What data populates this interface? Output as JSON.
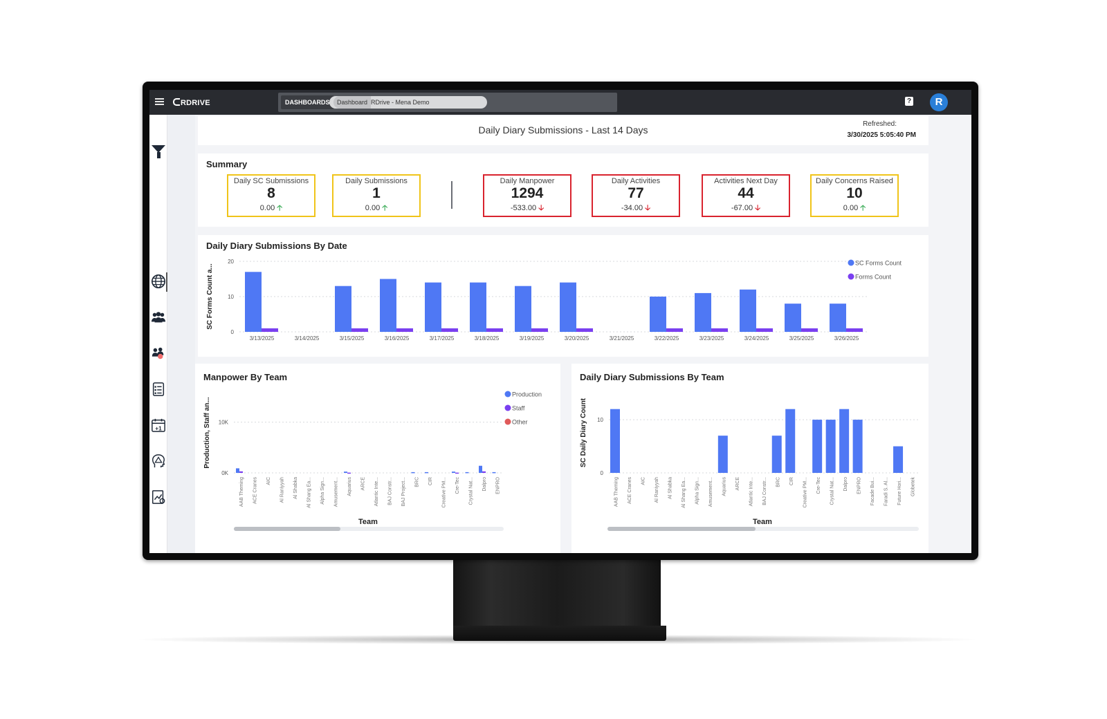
{
  "topbar": {
    "brand": "RDRIVE",
    "nav_tab": "DASHBOARDS",
    "crumb_1": "Dashboard",
    "crumb_2": "RDrive - Mena Demo",
    "help_icon": "help-icon",
    "avatar_letter": "R"
  },
  "sidebar": {
    "icons": [
      "filter-icon",
      "globe-icon",
      "team-icon",
      "team-alert-icon",
      "checklist-icon",
      "calendar-plus-icon",
      "head-alert-icon",
      "report-chart-icon"
    ]
  },
  "header": {
    "title": "Daily Diary Submissions - Last 14 Days",
    "refreshed_label": "Refreshed:",
    "refreshed_value": "3/30/2025 5:05:40 PM"
  },
  "summary": {
    "title": "Summary",
    "cards": [
      {
        "label": "Daily SC Submissions",
        "value": "8",
        "delta": "0.00",
        "trend": "up",
        "border": "#f0c419"
      },
      {
        "label": "Daily Submissions",
        "value": "1",
        "delta": "0.00",
        "trend": "up",
        "border": "#f0c419"
      },
      {
        "label": "Daily Manpower",
        "value": "1294",
        "delta": "-533.00",
        "trend": "down",
        "border": "#d9232e"
      },
      {
        "label": "Daily Activities",
        "value": "77",
        "delta": "-34.00",
        "trend": "down",
        "border": "#d9232e"
      },
      {
        "label": "Activities Next Day",
        "value": "44",
        "delta": "-67.00",
        "trend": "down",
        "border": "#d9232e"
      },
      {
        "label": "Daily Concerns Raised",
        "value": "10",
        "delta": "0.00",
        "trend": "up",
        "border": "#f0c419"
      }
    ]
  },
  "colors": {
    "blue": "#4f78f4",
    "purple": "#7a3ff0",
    "red": "#e05a5a"
  },
  "chart_data": [
    {
      "type": "bar",
      "title": "Daily Diary Submissions By Date",
      "ylabel": "SC Forms Count a...",
      "xlabel": "",
      "ylim": [
        0,
        20
      ],
      "yticks": [
        "0",
        "10",
        "20"
      ],
      "categories": [
        "3/13/2025",
        "3/14/2025",
        "3/15/2025",
        "3/16/2025",
        "3/17/2025",
        "3/18/2025",
        "3/19/2025",
        "3/20/2025",
        "3/21/2025",
        "3/22/2025",
        "3/23/2025",
        "3/24/2025",
        "3/25/2025",
        "3/26/2025"
      ],
      "series": [
        {
          "name": "SC Forms Count",
          "values": [
            17,
            0,
            13,
            15,
            14,
            14,
            13,
            14,
            0,
            10,
            11,
            12,
            8,
            8
          ]
        },
        {
          "name": "Forms Count",
          "values": [
            1,
            0,
            1,
            1,
            1,
            1,
            1,
            1,
            0,
            1,
            1,
            1,
            1,
            1
          ]
        }
      ],
      "legend": "top-right",
      "grid": true
    },
    {
      "type": "bar",
      "title": "Manpower By Team",
      "ylabel": "Production, Staff an...",
      "xlabel": "Team",
      "ylim": [
        0,
        12000
      ],
      "yticks": [
        "0K",
        "10K"
      ],
      "categories": [
        "AAB Theming",
        "ACE Cranes",
        "AIC",
        "Al Raniyyah",
        "Al Shabka",
        "Al Shang Ea...",
        "Alpha Sign...",
        "Amusement...",
        "Aquarius",
        "ARCE",
        "Atlantic Inte...",
        "BAJ Constr...",
        "BAJ Project...",
        "BRC",
        "CIR",
        "Creative PM...",
        "Cre-Tec",
        "Crystal Nat...",
        "Dalpro",
        "ENPRO"
      ],
      "series": [
        {
          "name": "Production",
          "values": [
            900,
            0,
            0,
            0,
            0,
            0,
            0,
            0,
            250,
            0,
            0,
            0,
            0,
            150,
            150,
            0,
            250,
            150,
            1400,
            150
          ]
        },
        {
          "name": "Staff",
          "values": [
            300,
            0,
            0,
            0,
            0,
            0,
            0,
            0,
            50,
            0,
            0,
            0,
            0,
            0,
            0,
            0,
            50,
            0,
            300,
            0
          ]
        },
        {
          "name": "Other",
          "values": [
            0,
            0,
            0,
            0,
            0,
            0,
            0,
            0,
            0,
            0,
            0,
            0,
            0,
            0,
            0,
            0,
            0,
            0,
            0,
            0
          ]
        }
      ],
      "legend": "top-right",
      "grid": true
    },
    {
      "type": "bar",
      "title": "Daily Diary Submissions By Team",
      "ylabel": "SC Daily Diary Count",
      "xlabel": "Team",
      "ylim": [
        0,
        13
      ],
      "yticks": [
        "0",
        "10"
      ],
      "categories": [
        "AAB Theming",
        "ACE Cranes",
        "AIC",
        "Al Raniyyah",
        "Al Shabka",
        "Al Shang Ea...",
        "Alpha Sign...",
        "Amusement...",
        "Aquarius",
        "ARCE",
        "Atlantic Inte...",
        "BAJ Constr...",
        "BRC",
        "CIR",
        "Creative PM...",
        "Cre-Tec",
        "Crystal Nat...",
        "Dalpro",
        "ENPRO",
        "Facade Bui...",
        "Faradi S. Al...",
        "Future Hori...",
        "Globetek"
      ],
      "series": [
        {
          "name": "SC Daily Diary Count",
          "values": [
            12,
            0,
            0,
            0,
            0,
            0,
            0,
            0,
            7,
            0,
            0,
            0,
            7,
            12,
            0,
            10,
            10,
            12,
            10,
            0,
            0,
            5,
            0
          ]
        }
      ],
      "grid": true
    }
  ]
}
